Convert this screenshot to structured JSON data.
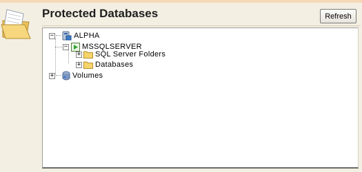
{
  "header": {
    "title": "Protected Databases",
    "refresh_label": "Refresh",
    "folder_icon": "open-folder-icon"
  },
  "tree": {
    "alpha": {
      "label": "ALPHA",
      "icon": "server-icon",
      "expanded": true
    },
    "mssqlserver": {
      "label": "MSSQLSERVER",
      "icon": "sql-instance-icon",
      "expanded": true
    },
    "sql_server_folders": {
      "label": "SQL Server Folders",
      "icon": "folder-icon",
      "expanded": false
    },
    "databases": {
      "label": "Databases",
      "icon": "folder-icon",
      "expanded": false
    },
    "volumes": {
      "label": "Volumes",
      "icon": "volume-icon",
      "expanded": false
    }
  },
  "colors": {
    "background": "#f3efe2",
    "accent_rule": "#f6d9b7",
    "tree_bg": "#ffffff"
  }
}
